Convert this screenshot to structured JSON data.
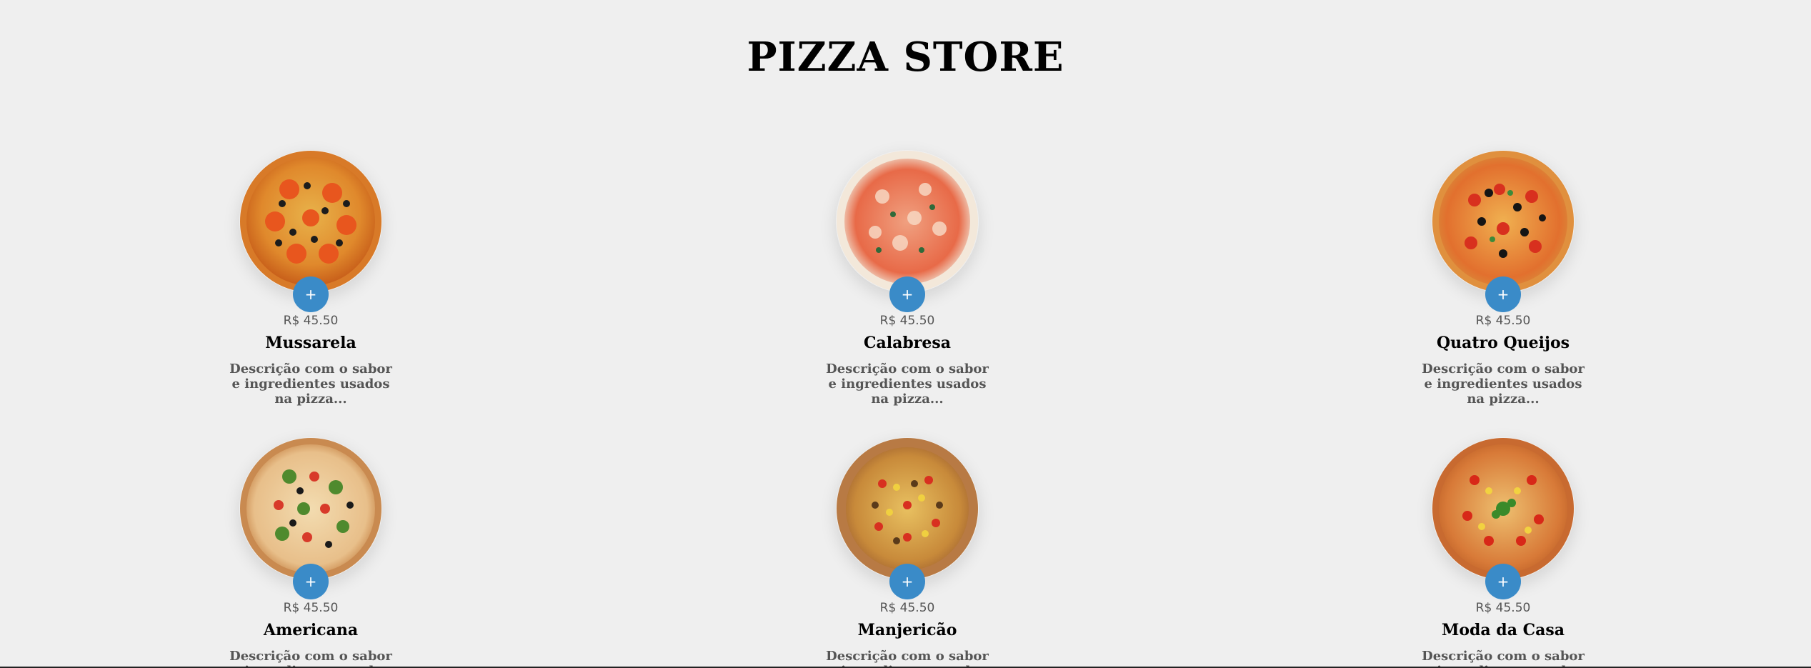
{
  "header": {
    "title": "PIZZA STORE"
  },
  "colors": {
    "background": "#efefef",
    "accent": "#3a8bc8"
  },
  "pizzas": [
    {
      "name": "Mussarela",
      "price": "R$ 45.50",
      "description": "Descrição com o sabor e ingredientes usados na pizza...",
      "add_label": "+",
      "icon": "pizza-mussarela-icon"
    },
    {
      "name": "Calabresa",
      "price": "R$ 45.50",
      "description": "Descrição com o sabor e ingredientes usados na pizza...",
      "add_label": "+",
      "icon": "pizza-calabresa-icon"
    },
    {
      "name": "Quatro Queijos",
      "price": "R$ 45.50",
      "description": "Descrição com o sabor e ingredientes usados na pizza...",
      "add_label": "+",
      "icon": "pizza-quatro-queijos-icon"
    },
    {
      "name": "Americana",
      "price": "R$ 45.50",
      "description": "Descrição com o sabor e ingredientes usados na pizza...",
      "add_label": "+",
      "icon": "pizza-americana-icon"
    },
    {
      "name": "Manjericão",
      "price": "R$ 45.50",
      "description": "Descrição com o sabor e ingredientes usados na pizza...",
      "add_label": "+",
      "icon": "pizza-manjericao-icon"
    },
    {
      "name": "Moda da Casa",
      "price": "R$ 45.50",
      "description": "Descrição com o sabor e ingredientes usados na pizza...",
      "add_label": "+",
      "icon": "pizza-moda-da-casa-icon"
    }
  ]
}
